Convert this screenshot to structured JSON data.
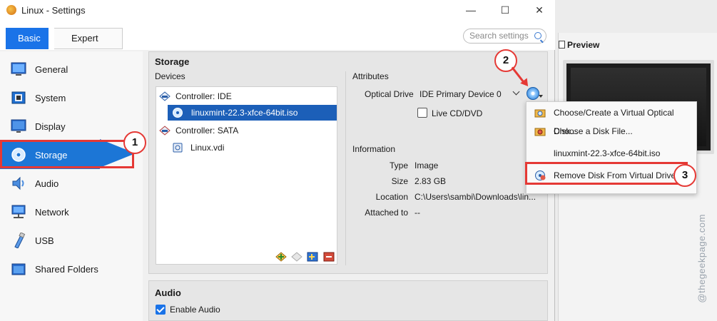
{
  "window": {
    "title": "Linux - Settings",
    "minimize": "—",
    "maximize": "☐",
    "close": "✕"
  },
  "tabs": [
    {
      "label": "Basic",
      "selected": true
    },
    {
      "label": "Expert",
      "selected": false
    }
  ],
  "search": {
    "placeholder": "Search settings"
  },
  "sidebar": {
    "items": [
      {
        "label": "General",
        "icon": "general-icon"
      },
      {
        "label": "System",
        "icon": "system-chip-icon"
      },
      {
        "label": "Display",
        "icon": "display-monitor-icon"
      },
      {
        "label": "Storage",
        "icon": "storage-disk-icon",
        "selected": true
      },
      {
        "label": "Audio",
        "icon": "speaker-icon"
      },
      {
        "label": "Network",
        "icon": "network-icon"
      },
      {
        "label": "USB",
        "icon": "usb-icon"
      },
      {
        "label": "Shared Folders",
        "icon": "folder-icon"
      }
    ]
  },
  "storage": {
    "title": "Storage",
    "devices_label": "Devices",
    "tree": [
      {
        "label": "Controller: IDE",
        "type": "controller"
      },
      {
        "label": "linuxmint-22.3-xfce-64bit.iso",
        "type": "optical",
        "selected": true
      },
      {
        "label": "Controller: SATA",
        "type": "controller"
      },
      {
        "label": "Linux.vdi",
        "type": "disk"
      }
    ],
    "attributes_label": "Attributes",
    "optical_drive_label": "Optical Drive",
    "optical_drive_value": "IDE Primary Device 0",
    "live_cd_label": "Live CD/DVD",
    "information_label": "Information",
    "info": [
      {
        "key": "Type",
        "value": "Image"
      },
      {
        "key": "Size",
        "value": "2.83 GB"
      },
      {
        "key": "Location",
        "value": "C:\\Users\\sambi\\Downloads\\lin..."
      },
      {
        "key": "Attached to",
        "value": "--"
      }
    ]
  },
  "menu": {
    "items": [
      {
        "label": "Choose/Create a Virtual Optical Disk...",
        "icon": "optical-folder-icon"
      },
      {
        "label": "Choose a Disk File...",
        "icon": "open-folder-icon"
      },
      {
        "label": "linuxmint-22.3-xfce-64bit.iso",
        "icon": ""
      },
      {
        "label": "Remove Disk From Virtual Drive",
        "icon": "remove-disk-icon"
      }
    ]
  },
  "audio": {
    "title": "Audio",
    "enable_label": "Enable Audio",
    "enabled": true
  },
  "preview": {
    "title": "Preview"
  },
  "callouts": {
    "one": "1",
    "two": "2",
    "three": "3"
  },
  "watermark": "@thegeekpage.com",
  "colors": {
    "accent": "#1a73e8",
    "callout": "#e53935",
    "selection": "#1c76d6"
  }
}
